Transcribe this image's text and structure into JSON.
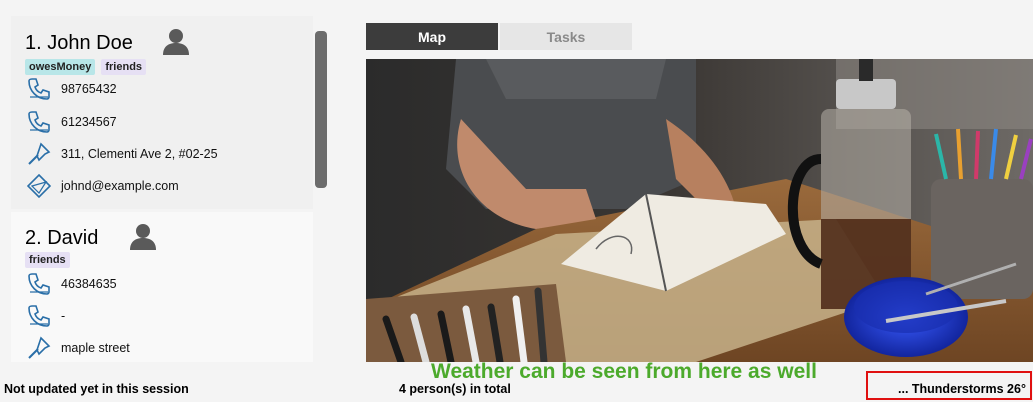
{
  "persons": [
    {
      "name": "1.  John Doe",
      "tags": [
        "owesMoney",
        "friends"
      ],
      "phone": "98765432",
      "phone2": "61234567",
      "address": "311, Clementi Ave 2, #02-25",
      "email": "johnd@example.com"
    },
    {
      "name": "2.  David",
      "tags": [
        "friends"
      ],
      "phone": "46384635",
      "phone2": "-",
      "address": "maple street"
    }
  ],
  "tabs": {
    "map": "Map",
    "tasks": "Tasks"
  },
  "status": {
    "sync": "Not updated yet in this session",
    "count": "4 person(s) in total",
    "weather": "... Thunderstorms 26°"
  },
  "annotation": "Weather can be seen from here as well",
  "colors": {
    "annotation": "#4caa2c",
    "highlight_border": "#e01010",
    "active_tab": "#3c3c3c"
  },
  "icons": [
    "person-icon",
    "phone-icon",
    "address-pin-icon",
    "email-icon"
  ]
}
